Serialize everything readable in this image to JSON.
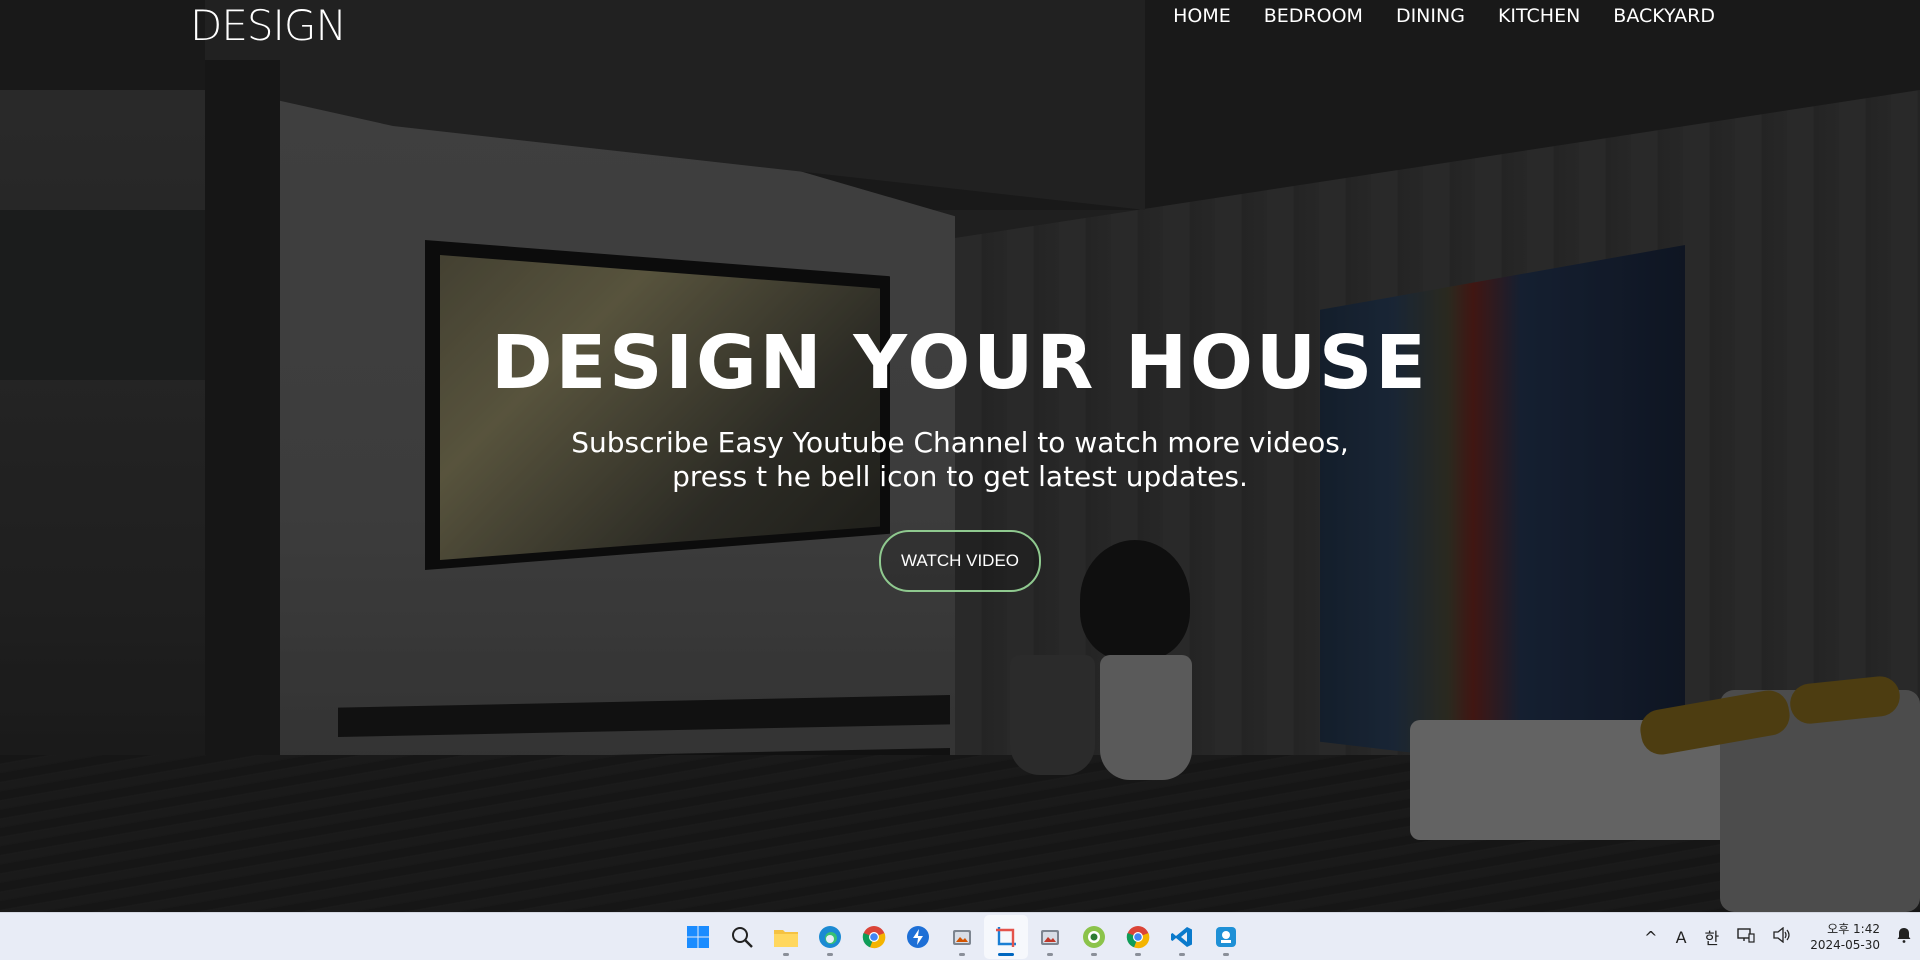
{
  "brand": {
    "logo": "DESIGN"
  },
  "nav": {
    "items": [
      {
        "label": "HOME"
      },
      {
        "label": "BEDROOM"
      },
      {
        "label": "DINING"
      },
      {
        "label": "KITCHEN"
      },
      {
        "label": "BACKYARD"
      }
    ]
  },
  "hero": {
    "title": "DESIGN YOUR HOUSE",
    "subtitle_line1": "Subscribe Easy Youtube Channel to watch more videos,",
    "subtitle_line2": "press t he bell icon to get latest updates.",
    "cta_label": "WATCH VIDEO"
  },
  "colors": {
    "cta_border": "#8fc98f",
    "text": "#ffffff",
    "taskbar_bg": "#e8ecf6"
  },
  "taskbar": {
    "apps": [
      {
        "name": "start-menu",
        "icon": "windows-logo-icon"
      },
      {
        "name": "search",
        "icon": "search-icon"
      },
      {
        "name": "file-explorer",
        "icon": "folder-icon"
      },
      {
        "name": "edge",
        "icon": "edge-icon"
      },
      {
        "name": "chrome",
        "icon": "chrome-icon"
      },
      {
        "name": "app-blue",
        "icon": "bolt-app-icon"
      },
      {
        "name": "photos-1",
        "icon": "photos-icon"
      },
      {
        "name": "snipping-tool",
        "icon": "snipping-tool-icon",
        "active": true
      },
      {
        "name": "photos-2",
        "icon": "photos-icon"
      },
      {
        "name": "app-green",
        "icon": "green-circle-app-icon"
      },
      {
        "name": "chrome-2",
        "icon": "chrome-icon"
      },
      {
        "name": "vscode",
        "icon": "vscode-icon"
      },
      {
        "name": "app-teal",
        "icon": "teal-app-icon"
      }
    ],
    "tray": {
      "chevron": "^",
      "ime_a": "A",
      "ime_ko": "한",
      "time": "오후 1:42",
      "date": "2024-05-30"
    }
  }
}
